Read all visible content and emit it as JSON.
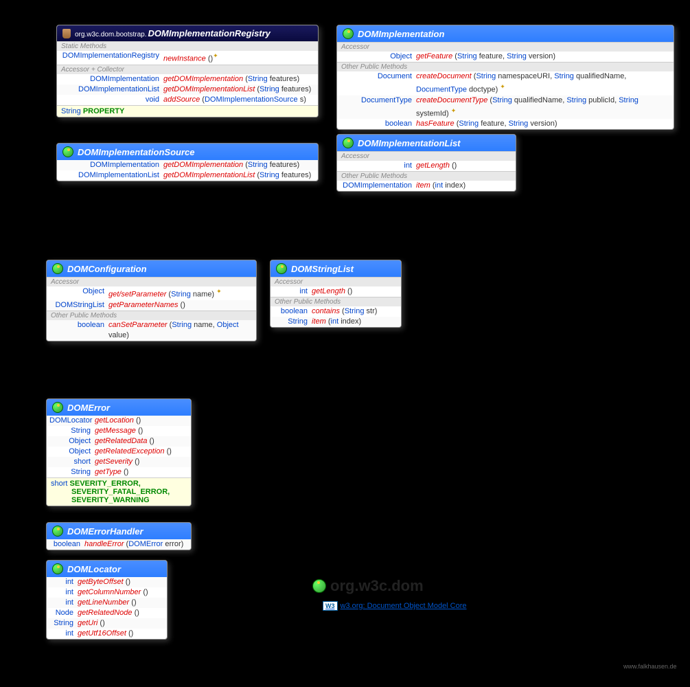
{
  "cards": {
    "registry": {
      "pkg": "org.w3c.dom.bootstrap.",
      "title": "DOMImplementationRegistry",
      "sec1": "Static Methods",
      "r1_ret": "DOMImplementationRegistry",
      "r1_m": "newInstance",
      "r1_p": " ()",
      "r1_t": "✦",
      "sec2": "Accessor + Collector",
      "r2_ret": "DOMImplementation",
      "r2_m": "getDOMImplementation",
      "r2_p1": " (",
      "r2_t1": "String",
      "r2_p2": " features)",
      "r3_ret": "DOMImplementationList",
      "r3_m": "getDOMImplementationList",
      "r3_p1": " (",
      "r3_t1": "String",
      "r3_p2": " features)",
      "r4_ret": "void",
      "r4_m": "addSource",
      "r4_p1": " (",
      "r4_t1": "DOMImplementationSource",
      "r4_p2": " s)",
      "c_type": "String",
      "c_name": "PROPERTY"
    },
    "impl": {
      "title": "DOMImplementation",
      "sec1": "Accessor",
      "r1_ret": "Object",
      "r1_m": "getFeature",
      "r1_p1": " (",
      "r1_t1": "String",
      "r1_p2": " feature, ",
      "r1_t2": "String",
      "r1_p3": " version)",
      "sec2": "Other Public Methods",
      "r2_ret": "Document",
      "r2_m": "createDocument",
      "r2_p1": " (",
      "r2_t1": "String",
      "r2_p2": " namespaceURI, ",
      "r2_t2": "String",
      "r2_p3": " qualifiedName, ",
      "r2_t3": "DocumentType",
      "r2_p4": " doctype) ",
      "r2_th": "✦",
      "r3_ret": "DocumentType",
      "r3_m": "createDocumentType",
      "r3_p1": " (",
      "r3_t1": "String",
      "r3_p2": " qualifiedName, ",
      "r3_t2": "String",
      "r3_p3": " publicId, ",
      "r3_t3": "String",
      "r3_p4": " systemId) ",
      "r3_th": "✦",
      "r4_ret": "boolean",
      "r4_m": "hasFeature",
      "r4_p1": " (",
      "r4_t1": "String",
      "r4_p2": " feature, ",
      "r4_t2": "String",
      "r4_p3": " version)"
    },
    "source": {
      "title": "DOMImplementationSource",
      "r1_ret": "DOMImplementation",
      "r1_m": "getDOMImplementation",
      "r1_p1": " (",
      "r1_t1": "String",
      "r1_p2": " features)",
      "r2_ret": "DOMImplementationList",
      "r2_m": "getDOMImplementationList",
      "r2_p1": " (",
      "r2_t1": "String",
      "r2_p2": " features)"
    },
    "list": {
      "title": "DOMImplementationList",
      "sec1": "Accessor",
      "r1_ret": "int",
      "r1_m": "getLength",
      "r1_p": " ()",
      "sec2": "Other Public Methods",
      "r2_ret": "DOMImplementation",
      "r2_m": "item",
      "r2_p1": " (",
      "r2_t1": "int",
      "r2_p2": " index)"
    },
    "config": {
      "title": "DOMConfiguration",
      "sec1": "Accessor",
      "r1_ret": "Object",
      "r1_m": "get/setParameter",
      "r1_p1": " (",
      "r1_t1": "String",
      "r1_p2": " name) ",
      "r1_th": "✦",
      "r2_ret": "DOMStringList",
      "r2_m": "getParameterNames",
      "r2_p": " ()",
      "sec2": "Other Public Methods",
      "r3_ret": "boolean",
      "r3_m": "canSetParameter",
      "r3_p1": " (",
      "r3_t1": "String",
      "r3_p2": " name, ",
      "r3_t2": "Object",
      "r3_p3": " value)"
    },
    "stringlist": {
      "title": "DOMStringList",
      "sec1": "Accessor",
      "r1_ret": "int",
      "r1_m": "getLength",
      "r1_p": " ()",
      "sec2": "Other Public Methods",
      "r2_ret": "boolean",
      "r2_m": "contains",
      "r2_p1": " (",
      "r2_t1": "String",
      "r2_p2": " str)",
      "r3_ret": "String",
      "r3_m": "item",
      "r3_p1": " (",
      "r3_t1": "int",
      "r3_p2": " index)"
    },
    "error": {
      "title": "DOMError",
      "r1_ret": "DOMLocator",
      "r1_m": "getLocation",
      "r1_p": " ()",
      "r2_ret": "String",
      "r2_m": "getMessage",
      "r2_p": " ()",
      "r3_ret": "Object",
      "r3_m": "getRelatedData",
      "r3_p": " ()",
      "r4_ret": "Object",
      "r4_m": "getRelatedException",
      "r4_p": " ()",
      "r5_ret": "short",
      "r5_m": "getSeverity",
      "r5_p": " ()",
      "r6_ret": "String",
      "r6_m": "getType",
      "r6_p": " ()",
      "c_type": "short",
      "c1": "SEVERITY_ERROR,",
      "c2": "SEVERITY_FATAL_ERROR,",
      "c3": "SEVERITY_WARNING"
    },
    "handler": {
      "title": "DOMErrorHandler",
      "r1_ret": "boolean",
      "r1_m": "handleError",
      "r1_p1": " (",
      "r1_t1": "DOMError",
      "r1_p2": " error)"
    },
    "locator": {
      "title": "DOMLocator",
      "r1_ret": "int",
      "r1_m": "getByteOffset",
      "r1_p": " ()",
      "r2_ret": "int",
      "r2_m": "getColumnNumber",
      "r2_p": " ()",
      "r3_ret": "int",
      "r3_m": "getLineNumber",
      "r3_p": " ()",
      "r4_ret": "Node",
      "r4_m": "getRelatedNode",
      "r4_p": " ()",
      "r5_ret": "String",
      "r5_m": "getUri",
      "r5_p": " ()",
      "r6_ret": "int",
      "r6_m": "getUtf16Offset",
      "r6_p": " ()"
    }
  },
  "package_title": "org.w3c.dom",
  "w3_text": "w3.org: Document Object Model Core",
  "w3_badge": "W3",
  "footer": "www.falkhausen.de"
}
